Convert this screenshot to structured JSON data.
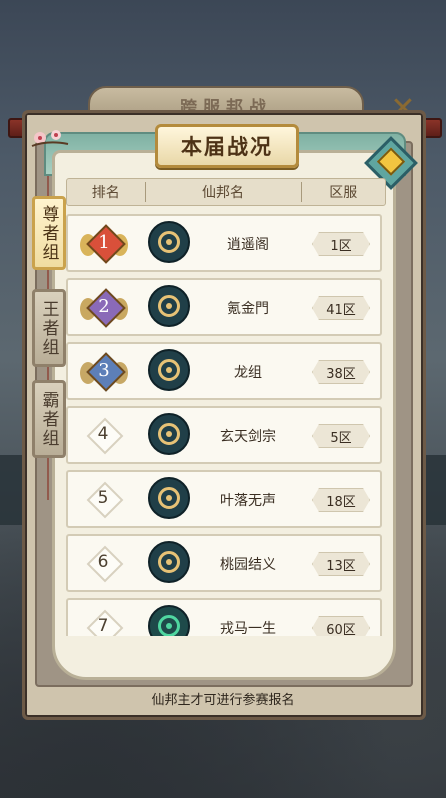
{
  "window": {
    "title": "跨服邦战",
    "subtitle": "本届战况"
  },
  "columns": {
    "rank": "排名",
    "guild": "仙邦名",
    "zone": "区服"
  },
  "tabs": [
    {
      "label": "尊者组",
      "active": true
    },
    {
      "label": "王者组",
      "active": false
    },
    {
      "label": "霸者组",
      "active": false
    }
  ],
  "rows": [
    {
      "rank": "1",
      "name": "逍遥阁",
      "zone": "1区",
      "medal": "gold",
      "gem_color": "#d9503a",
      "emblem": "gold"
    },
    {
      "rank": "2",
      "name": "氪金門",
      "zone": "41区",
      "medal": "silver",
      "gem_color": "#8a6ab8",
      "emblem": "gold"
    },
    {
      "rank": "3",
      "name": "龙组",
      "zone": "38区",
      "medal": "bronze",
      "gem_color": "#5d7fb8",
      "emblem": "gold"
    },
    {
      "rank": "4",
      "name": "玄天剑宗",
      "zone": "5区",
      "medal": "none",
      "emblem": "gold"
    },
    {
      "rank": "5",
      "name": "叶落无声",
      "zone": "18区",
      "medal": "none",
      "emblem": "gold"
    },
    {
      "rank": "6",
      "name": "桃园结义",
      "zone": "13区",
      "medal": "none",
      "emblem": "gold"
    },
    {
      "rank": "7",
      "name": "戎马一生",
      "zone": "60区",
      "medal": "none",
      "emblem": "green"
    }
  ],
  "background": {
    "left_fragment": "邦",
    "right_fragment": "者"
  },
  "footer": {
    "note": "仙邦主才可进行参赛报名"
  },
  "colors": {
    "roof": "#8a3328",
    "accent_gold": "#caa24c",
    "panel_bg": "#f3efe0"
  }
}
